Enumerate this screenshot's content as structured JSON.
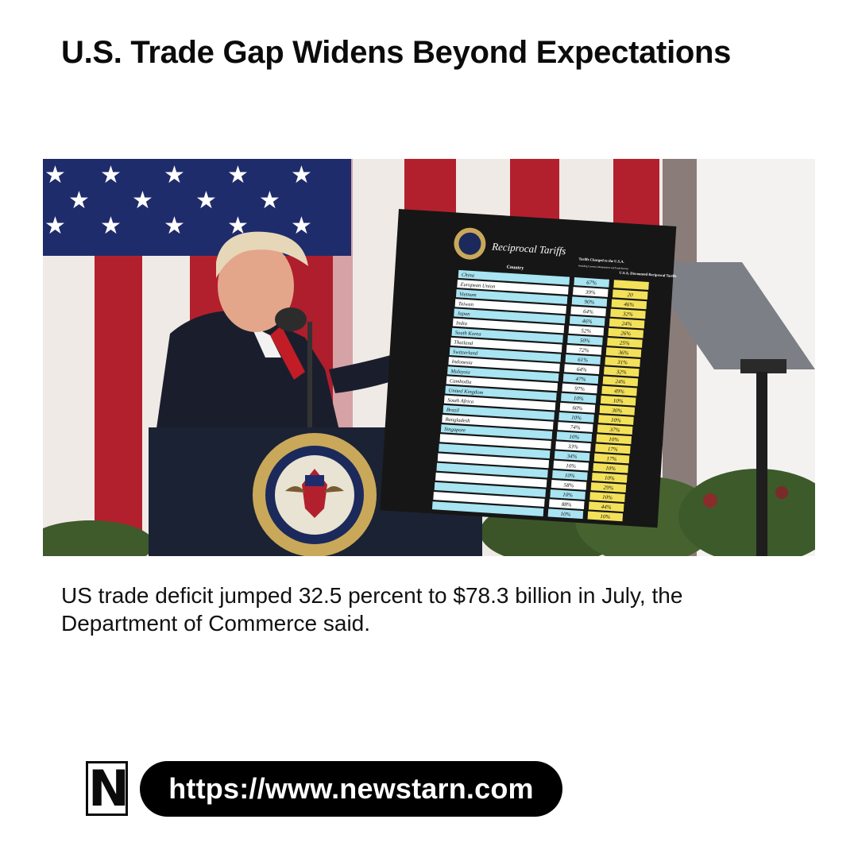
{
  "headline": "U.S. Trade Gap Widens Beyond Expectations",
  "caption": "US trade deficit jumped 32.5 percent to $78.3 billion in July, the Department of Commerce said.",
  "brand": {
    "logo_letter": "N",
    "url": "https://www.newstarn.com"
  },
  "photo": {
    "board": {
      "title": "Reciprocal Tariffs",
      "col_country": "Country",
      "col_charged": "Tariffs Charged to the U.S.A.",
      "col_charged_note": "Including Currency Manipulation and Trade Barriers",
      "col_discounted": "U.S.A. Discounted Reciprocal Tariffs",
      "rows": [
        {
          "country": "China",
          "charged": "67%",
          "discounted": ""
        },
        {
          "country": "European Union",
          "charged": "39%",
          "discounted": "20"
        },
        {
          "country": "Vietnam",
          "charged": "90%",
          "discounted": "46%"
        },
        {
          "country": "Taiwan",
          "charged": "64%",
          "discounted": "32%"
        },
        {
          "country": "Japan",
          "charged": "46%",
          "discounted": "24%"
        },
        {
          "country": "India",
          "charged": "52%",
          "discounted": "26%"
        },
        {
          "country": "South Korea",
          "charged": "50%",
          "discounted": "25%"
        },
        {
          "country": "Thailand",
          "charged": "72%",
          "discounted": "36%"
        },
        {
          "country": "Switzerland",
          "charged": "61%",
          "discounted": "31%"
        },
        {
          "country": "Indonesia",
          "charged": "64%",
          "discounted": "32%"
        },
        {
          "country": "Malaysia",
          "charged": "47%",
          "discounted": "24%"
        },
        {
          "country": "Cambodia",
          "charged": "97%",
          "discounted": "49%"
        },
        {
          "country": "United Kingdom",
          "charged": "10%",
          "discounted": "10%"
        },
        {
          "country": "South Africa",
          "charged": "60%",
          "discounted": "30%"
        },
        {
          "country": "Brazil",
          "charged": "10%",
          "discounted": "10%"
        },
        {
          "country": "Bangladesh",
          "charged": "74%",
          "discounted": "37%"
        },
        {
          "country": "Singapore",
          "charged": "10%",
          "discounted": "10%"
        },
        {
          "country": "",
          "charged": "33%",
          "discounted": "17%"
        },
        {
          "country": "",
          "charged": "34%",
          "discounted": "17%"
        },
        {
          "country": "",
          "charged": "10%",
          "discounted": "10%"
        },
        {
          "country": "",
          "charged": "10%",
          "discounted": "10%"
        },
        {
          "country": "",
          "charged": "58%",
          "discounted": "29%"
        },
        {
          "country": "",
          "charged": "10%",
          "discounted": "10%"
        },
        {
          "country": "",
          "charged": "88%",
          "discounted": "44%"
        },
        {
          "country": "",
          "charged": "10%",
          "discounted": "10%"
        }
      ]
    },
    "seal_text": "SEAL OF THE PRESIDENT OF THE UNITED STATES",
    "colors": {
      "flag_blue": "#1f2c6b",
      "flag_red": "#b3202d",
      "board_bg": "#161616",
      "country_cell": "#a8e4f2",
      "discount_cell": "#f3e15a",
      "podium": "#1b2233",
      "seal_gold": "#c9a85a"
    }
  }
}
